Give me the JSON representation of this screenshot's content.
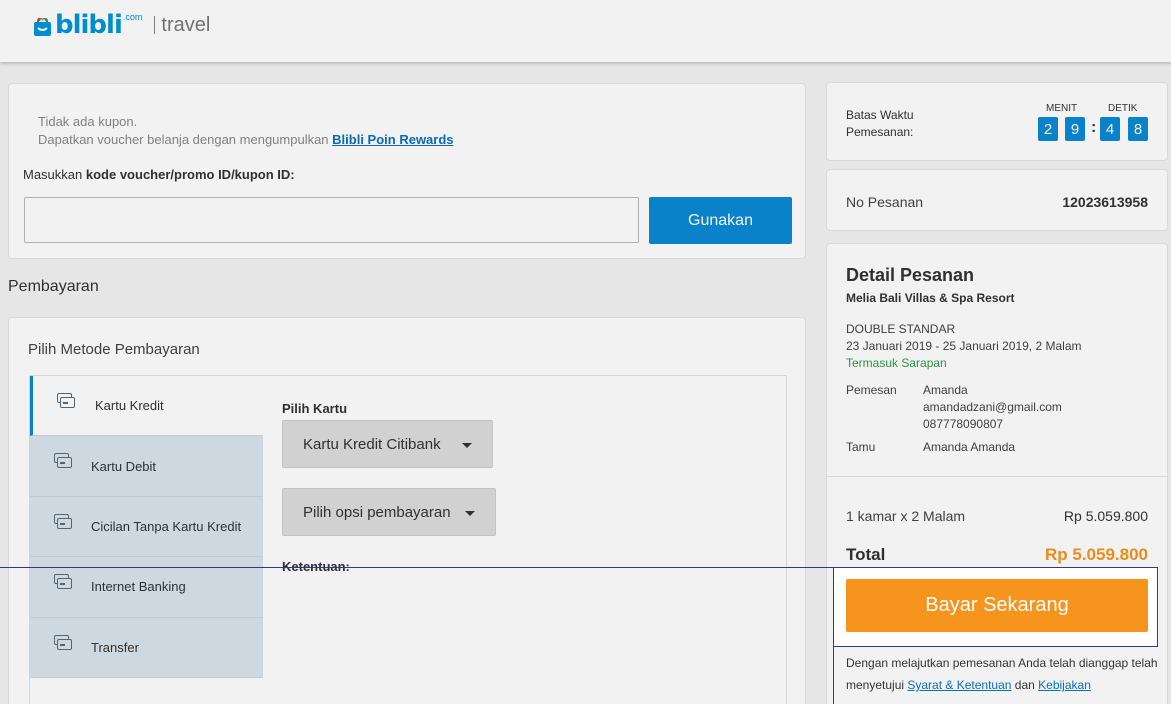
{
  "header": {
    "logo_word": "blibli",
    "logo_com": ".com",
    "logo_section": "travel"
  },
  "coupon": {
    "info_line1": "Tidak ada kupon.",
    "info_line2": "Dapatkan voucher belanja dengan mengumpulkan ",
    "info_link": "Blibli Poin Rewards",
    "label_prefix": "Masukkan ",
    "label_bold": "kode voucher/promo ID/kupon ID:",
    "input_value": "",
    "apply_button": "Gunakan"
  },
  "payment": {
    "section_title": "Pembayaran",
    "subtitle": "Pilih Metode Pembayaran",
    "methods": [
      {
        "label": "Kartu Kredit",
        "active": true
      },
      {
        "label": "Kartu Debit",
        "active": false
      },
      {
        "label": "Cicilan Tanpa Kartu Kredit",
        "active": false
      },
      {
        "label": "Internet Banking",
        "active": false
      },
      {
        "label": "Transfer",
        "active": false
      }
    ],
    "pick_card_label": "Pilih Kartu",
    "card_select": "Kartu Kredit Citibank",
    "option_select": "Pilih opsi pembayaran",
    "terms_label": "Ketentuan:"
  },
  "timer": {
    "label_line1": "Batas Waktu",
    "label_line2": "Pemesanan:",
    "minutes_caption": "MENIT",
    "seconds_caption": "DETIK",
    "minute_digits": [
      "2",
      "9"
    ],
    "second_digits": [
      "4",
      "8"
    ],
    "separator": ":"
  },
  "order": {
    "label": "No Pesanan",
    "number": "12023613958"
  },
  "detail": {
    "title": "Detail Pesanan",
    "hotel": "Melia Bali Villas & Spa Resort",
    "room_type": "DOUBLE STANDAR",
    "dates": "23 Januari 2019 - 25 Januari 2019, 2 Malam",
    "breakfast": "Termasuk Sarapan",
    "booker_label": "Pemesan",
    "booker_name": "Amanda",
    "booker_email": "amandadzani@gmail.com",
    "booker_phone": "087778090807",
    "guest_label": "Tamu",
    "guest_name": "Amanda Amanda",
    "price_label": "1 kamar x 2 Malam",
    "price_value": "Rp 5.059.800",
    "total_label": "Total",
    "total_value": "Rp 5.059.800"
  },
  "checkout": {
    "pay_button": "Bayar Sekarang",
    "legal_text": "Dengan melajutkan pemesanan Anda telah dianggap telah menyetujui ",
    "legal_link1": "Syarat & Ketentuan",
    "legal_and": " dan ",
    "legal_link2": "Kebijakan"
  },
  "colors": {
    "accent_blue": "#0a8ad4",
    "accent_orange": "#f7941d",
    "breakfast_green": "#2e9e4a"
  }
}
